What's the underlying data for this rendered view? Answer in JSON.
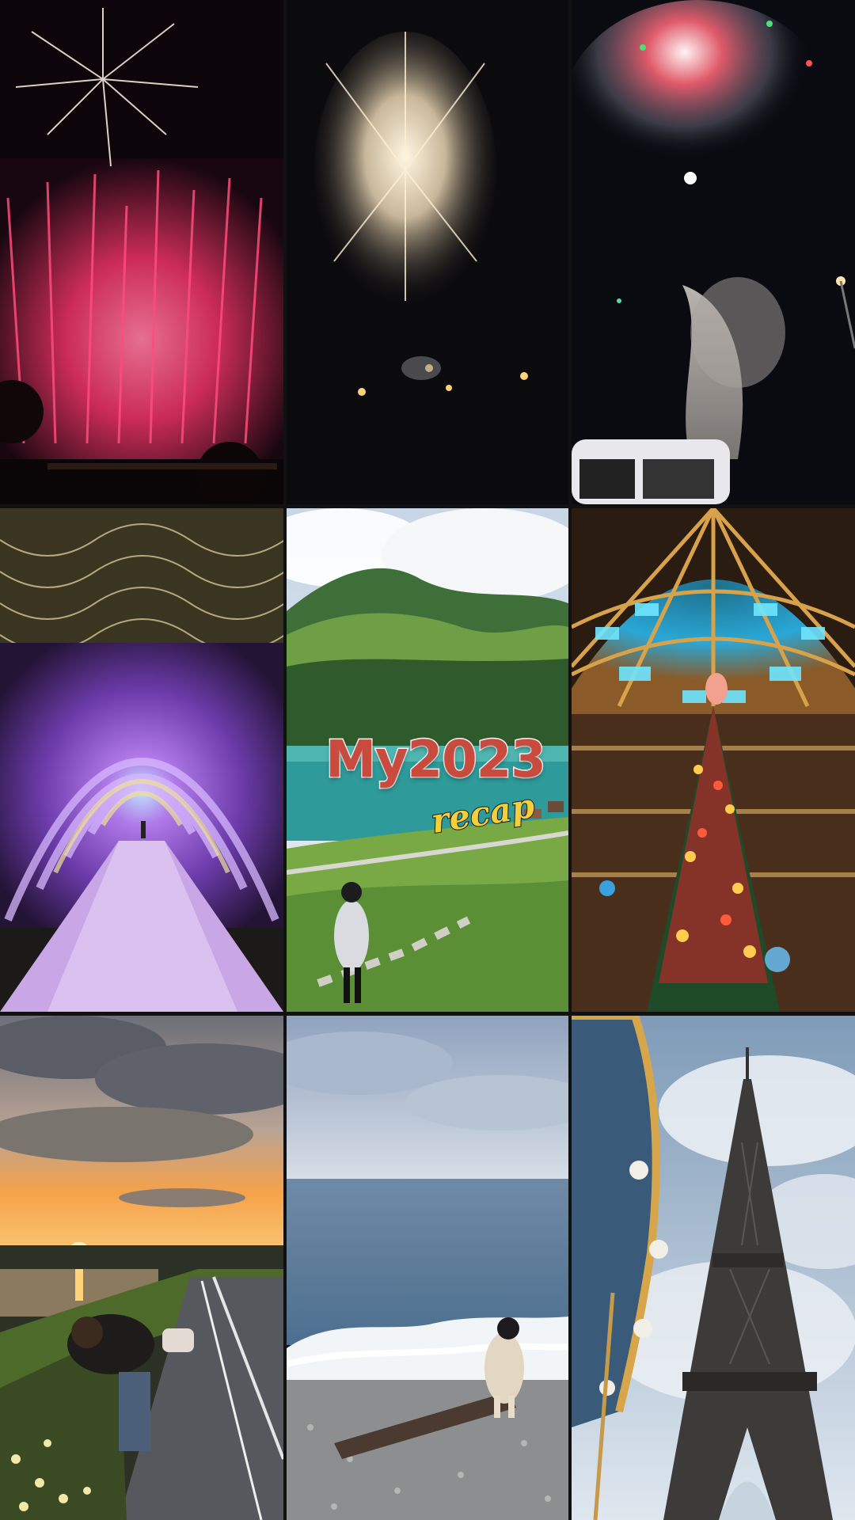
{
  "overlay": {
    "title": "My2023",
    "subtitle": "recap"
  },
  "tiles": [
    {
      "name": "fireworks-red",
      "row": 1,
      "col": 1
    },
    {
      "name": "fireworks-white",
      "row": 1,
      "col": 2
    },
    {
      "name": "fireworks-smoke",
      "row": 1,
      "col": 3
    },
    {
      "name": "light-tunnel",
      "row": 2,
      "col": 1
    },
    {
      "name": "mountain-lake",
      "row": 2,
      "col": 2
    },
    {
      "name": "galeries-dome-christmas-tree",
      "row": 2,
      "col": 3
    },
    {
      "name": "sunset-path",
      "row": 3,
      "col": 1
    },
    {
      "name": "seaside-waves",
      "row": 3,
      "col": 2
    },
    {
      "name": "eiffel-tower",
      "row": 3,
      "col": 3
    }
  ],
  "colors": {
    "title": "#c84b3d",
    "subtitle": "#f2cf3b",
    "night_sky": "#0b0a10",
    "red_fireworks": "#ff3d6e",
    "tunnel_purple": "#9a5fd8",
    "dome_blue": "#2aa7d6",
    "sunset": "#f6a24a",
    "sea": "#4d6f8f"
  }
}
